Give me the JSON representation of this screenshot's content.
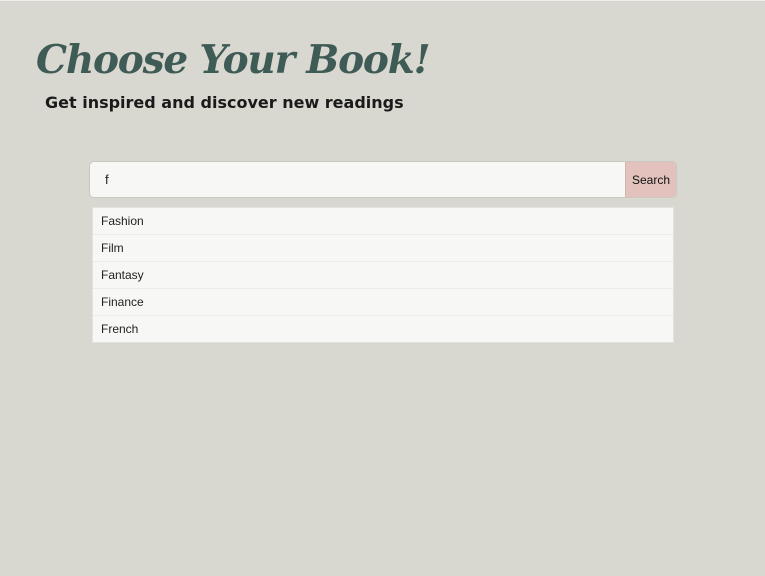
{
  "header": {
    "title": "Choose Your Book!",
    "subtitle": "Get inspired and discover new readings"
  },
  "search": {
    "value": "f",
    "button_label": "Search"
  },
  "suggestions": [
    "Fashion",
    "Film",
    "Fantasy",
    "Finance",
    "French"
  ],
  "colors": {
    "background": "#d8d7d0",
    "title": "#3f5b56",
    "search_button": "#e3c2bd",
    "input_background": "#f7f7f5"
  }
}
